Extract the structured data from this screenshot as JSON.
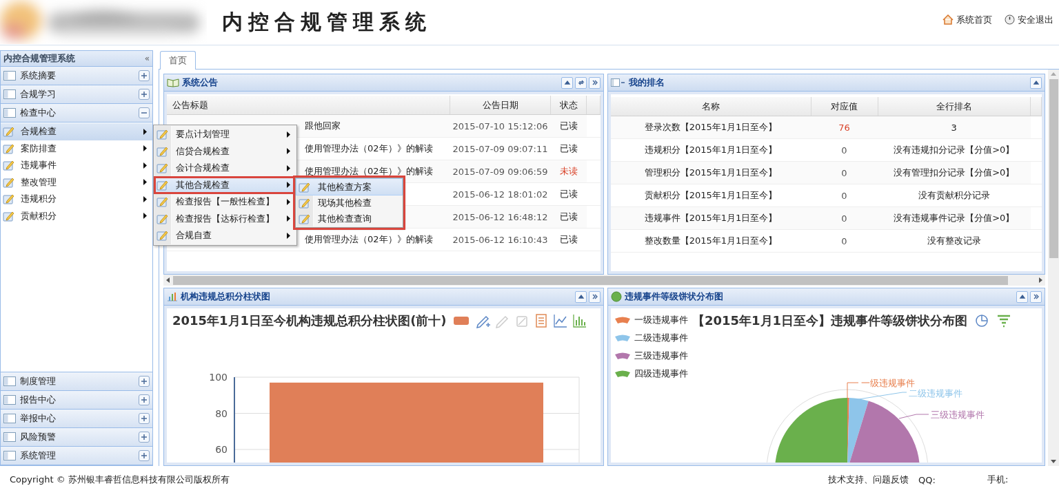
{
  "header": {
    "title": "内控合规管理系统",
    "links": [
      {
        "kind": "home",
        "label": "系统首页"
      },
      {
        "kind": "logout",
        "label": "安全退出"
      }
    ]
  },
  "sidebar": {
    "title": "内控合规管理系统",
    "collapse_glyph": "«",
    "sections": [
      {
        "label": "系统摘要",
        "expanded": false
      },
      {
        "label": "合规学习",
        "expanded": false
      },
      {
        "label": "检查中心",
        "expanded": true,
        "items": [
          {
            "label": "合规检查",
            "selected": true
          },
          {
            "label": "案防排查",
            "selected": false
          },
          {
            "label": "违规事件",
            "selected": false
          },
          {
            "label": "整改管理",
            "selected": false
          },
          {
            "label": "违规积分",
            "selected": false
          },
          {
            "label": "贡献积分",
            "selected": false
          }
        ]
      },
      {
        "label": "制度管理",
        "expanded": false
      },
      {
        "label": "报告中心",
        "expanded": false
      },
      {
        "label": "举报中心",
        "expanded": false
      },
      {
        "label": "风险预警",
        "expanded": false
      },
      {
        "label": "系统管理",
        "expanded": false
      }
    ]
  },
  "tabs": [
    {
      "label": "首页",
      "selected": true
    }
  ],
  "announcements": {
    "title": "系统公告",
    "columns": [
      "公告标题",
      "公告日期",
      "状态"
    ],
    "rows": [
      {
        "title": "跟他回家",
        "date": "2015-07-10 15:12:06",
        "status": "已读",
        "unread": false
      },
      {
        "title": "使用管理办法（02年）》的解读",
        "date": "2015-07-09 09:07:11",
        "status": "已读",
        "unread": false
      },
      {
        "title": "使用管理办法（02年）》的解读",
        "date": "2015-07-09 09:06:59",
        "status": "未读",
        "unread": true
      },
      {
        "date": "2015-06-12 18:01:02",
        "status": "已读",
        "unread": false
      },
      {
        "date": "2015-06-12 16:48:12",
        "status": "已读",
        "unread": false
      },
      {
        "title": "使用管理办法（02年）》的解读",
        "date": "2015-06-12 16:10:43",
        "status": "已读",
        "unread": false
      }
    ]
  },
  "ranking": {
    "title": "我的排名",
    "columns": [
      "名称",
      "对应值",
      "全行排名"
    ],
    "rows": [
      {
        "name": "登录次数【2015年1月1日至今】",
        "value": "76",
        "highlight": true,
        "rank": "3"
      },
      {
        "name": "违规积分【2015年1月1日至今】",
        "value": "0",
        "highlight": false,
        "rank": "没有违规扣分记录【分值>0】"
      },
      {
        "name": "管理积分【2015年1月1日至今】",
        "value": "0",
        "highlight": false,
        "rank": "没有管理扣分记录【分值>0】"
      },
      {
        "name": "贡献积分【2015年1月1日至今】",
        "value": "0",
        "highlight": false,
        "rank": "没有贡献积分记录"
      },
      {
        "name": "违规事件【2015年1月1日至今】",
        "value": "0",
        "highlight": false,
        "rank": "没有违规事件记录【分值>0】"
      },
      {
        "name": "整改数量【2015年1月1日至今】",
        "value": "0",
        "highlight": false,
        "rank": "没有整改记录"
      }
    ]
  },
  "bar_panel": {
    "title": "机构违规总积分柱状图",
    "chart_data": {
      "type": "bar",
      "title": "2015年1月1日至今机构违规总积分柱状图(前十)",
      "ylim": [
        40,
        100
      ],
      "yticks": [
        60,
        80,
        100
      ],
      "series": [
        {
          "color": "#e07f58",
          "values": [
            97
          ]
        }
      ]
    }
  },
  "pie_panel": {
    "title": "违规事件等级饼状分布图",
    "chart_title": "【2015年1月1日至今】违规事件等级饼状分布图",
    "legend": [
      {
        "label": "一级违规事件",
        "color": "#e8804f"
      },
      {
        "label": "二级违规事件",
        "color": "#8ec5ea"
      },
      {
        "label": "三级违规事件",
        "color": "#b277ac"
      },
      {
        "label": "四级违规事件",
        "color": "#6ab04c"
      }
    ],
    "slice_labels": [
      "一级违规事件",
      "二级违规事件",
      "三级违规事件"
    ]
  },
  "menu": {
    "items": [
      {
        "label": "要点计划管理",
        "selected": false,
        "annotated": false
      },
      {
        "label": "信贷合规检查",
        "selected": false,
        "annotated": false
      },
      {
        "label": "会计合规检查",
        "selected": false,
        "annotated": false
      },
      {
        "label": "其他合规检查",
        "selected": true,
        "annotated": true
      },
      {
        "label": "检查报告【一般性检查】",
        "selected": false,
        "annotated": false
      },
      {
        "label": "检查报告【达标行检查】",
        "selected": false,
        "annotated": false
      },
      {
        "label": "合规自查",
        "selected": false,
        "annotated": false
      }
    ],
    "submenu": {
      "annotated": true,
      "items": [
        {
          "label": "其他检查方案",
          "selected": true
        },
        {
          "label": "现场其他检查",
          "selected": false
        },
        {
          "label": "其他检查查询",
          "selected": false
        }
      ]
    }
  },
  "footer": {
    "copyright": "Copyright © 苏州银丰睿哲信息科技有限公司版权所有",
    "support": "技术支持、问题反馈",
    "qq_label": "QQ:",
    "phone_label": "手机:"
  }
}
